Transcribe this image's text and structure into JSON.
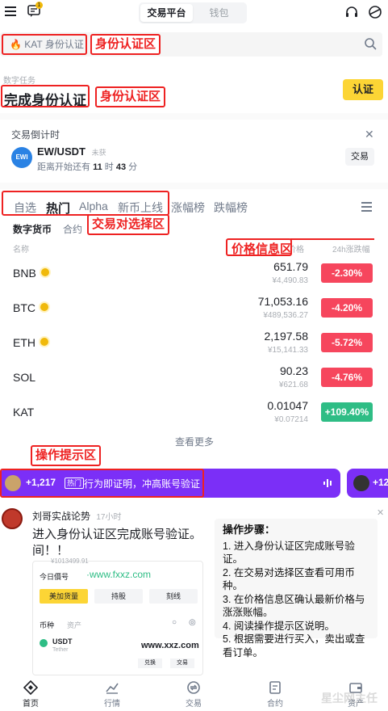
{
  "header": {
    "seg": [
      "交易平台",
      "钱包"
    ],
    "notif_badge": "1"
  },
  "search": {
    "tag": "KAT 身份认证"
  },
  "annotations": {
    "identity_zone": "身份认证区",
    "identity_zone_2": "身份认证区",
    "pair_zone": "交易对选择区",
    "price_zone": "价格信息区",
    "tips_zone": "操作提示区"
  },
  "task": {
    "subtitle": "数字任务",
    "title": "完成身份认证",
    "button": "认证"
  },
  "countdown": {
    "heading": "交易倒计时",
    "pair": "EW/USDT",
    "status": "未获",
    "prefix": "距离开始还有",
    "hours": "11",
    "hour_unit": "时",
    "minutes": "43",
    "minute_unit": "分",
    "button": "交易",
    "logo": "EWI"
  },
  "tabs": [
    "自选",
    "热门",
    "Alpha",
    "新币上线",
    "涨幅榜",
    "跌幅榜"
  ],
  "subtabs": [
    "数字货币",
    "合约"
  ],
  "columns": {
    "name": "名称",
    "price": "价格",
    "change": "24h涨跌幅"
  },
  "markets": [
    {
      "symbol": "BNB",
      "price": "651.79",
      "cny": "¥4,490.83",
      "change": "-2.30%",
      "dir": "down",
      "badge": true
    },
    {
      "symbol": "BTC",
      "price": "71,053.16",
      "cny": "¥489,536.27",
      "change": "-4.20%",
      "dir": "down",
      "badge": true
    },
    {
      "symbol": "ETH",
      "price": "2,197.58",
      "cny": "¥15,141.33",
      "change": "-5.72%",
      "dir": "down",
      "badge": true
    },
    {
      "symbol": "SOL",
      "price": "90.23",
      "cny": "¥621.68",
      "change": "-4.76%",
      "dir": "down",
      "badge": false
    },
    {
      "symbol": "KAT",
      "price": "0.01047",
      "cny": "¥0.07214",
      "change": "+109.40%",
      "dir": "up",
      "badge": false
    }
  ],
  "see_more": "查看更多",
  "live": {
    "count": "+1,217",
    "tag": "热门",
    "text": "行为即证明，冲高账号验证",
    "count2": "+12"
  },
  "post": {
    "author": "刘哥实战论势",
    "time": "17小时",
    "line1": "进入身份认证区完成账号验证。",
    "line2": "间！！"
  },
  "steps": {
    "title": "操作步骤：",
    "items": [
      "1. 进入身份认证区完成账号验证。",
      "2. 在交易对选择区查看可用币种。",
      "3. 在价格信息区确认最新价格与涨涨账幅。",
      "4. 阅读操作提示区说明。",
      "5. 根据需要进行买入，卖出或查看订单。"
    ]
  },
  "mini": {
    "top": "¥1013499.91",
    "date": "今日價号",
    "url": "www.fxxz.com",
    "btns": [
      "美加货量",
      "持股",
      "刻线"
    ],
    "tabs": [
      "币种",
      "资产"
    ],
    "coin": "USDT",
    "coin_sub": "Tether",
    "url2": "www.xxz.com",
    "act": [
      "兑换",
      "交易"
    ]
  },
  "nav": [
    "首页",
    "行情",
    "交易",
    "合约",
    "资产"
  ],
  "watermark": "星尘网主任"
}
